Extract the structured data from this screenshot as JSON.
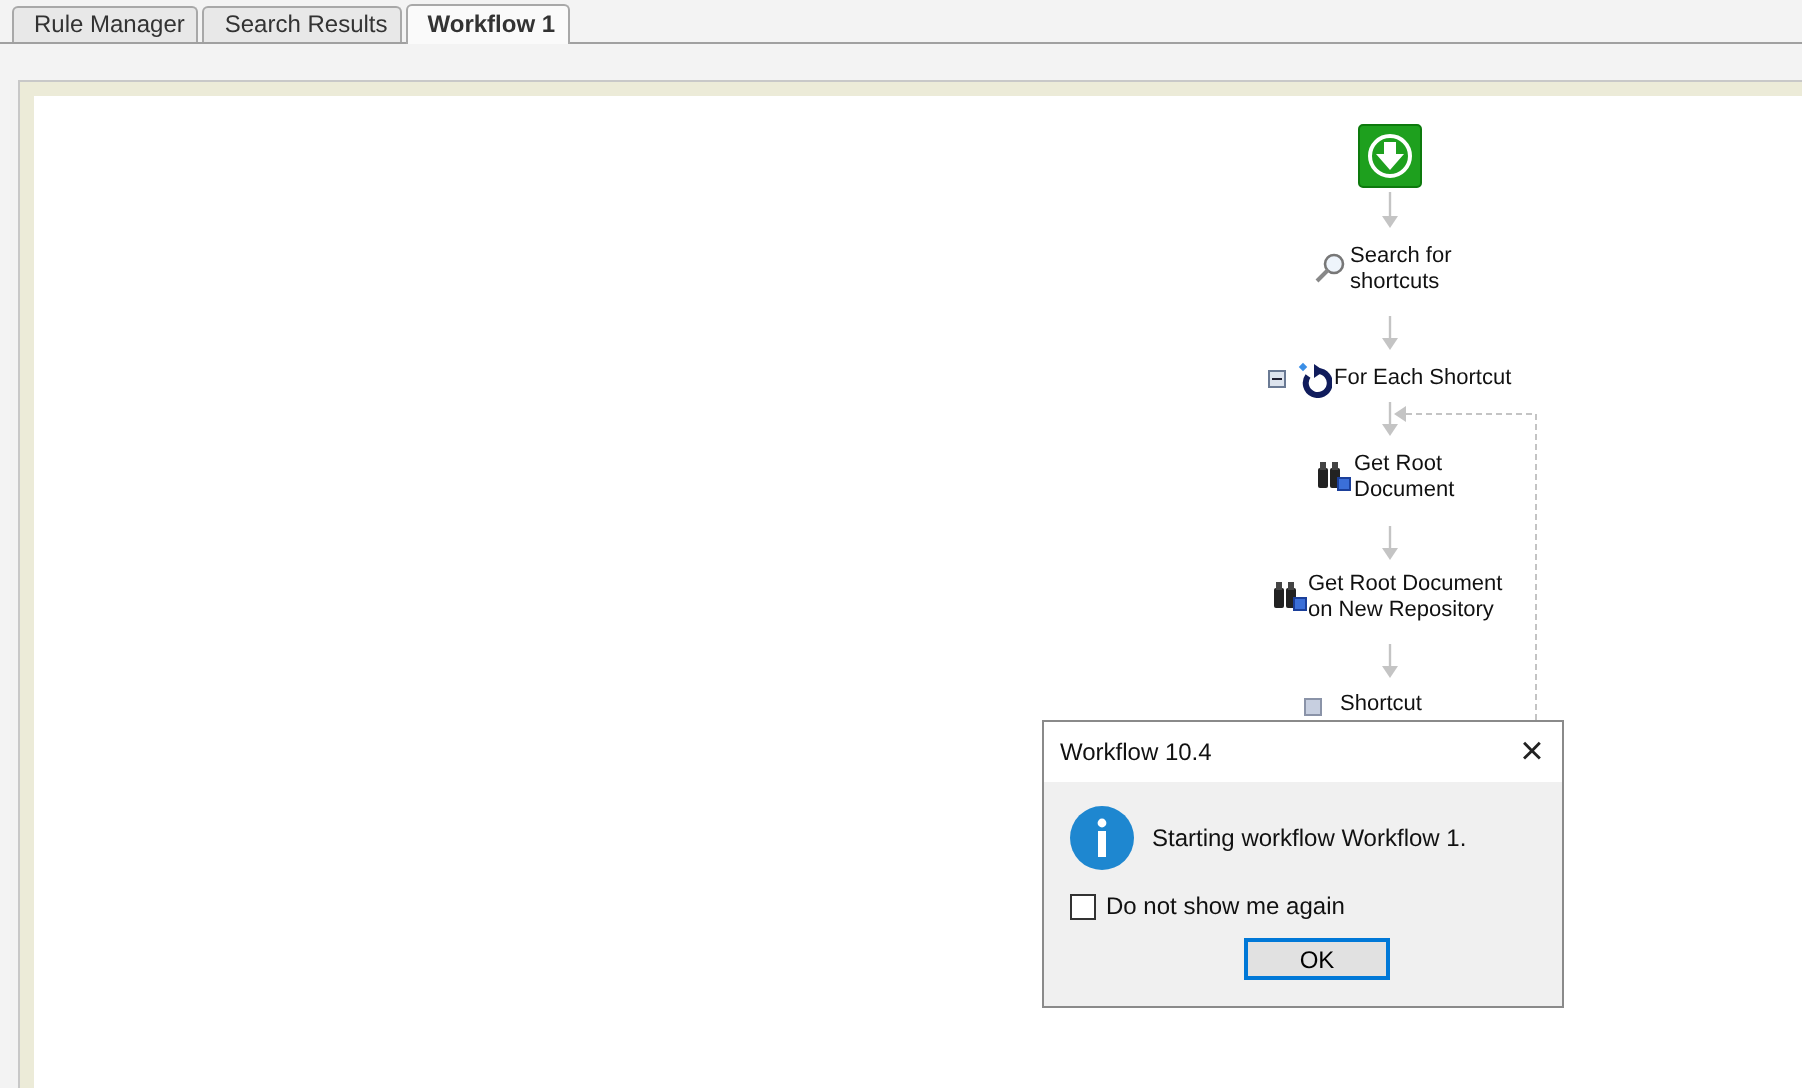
{
  "tabs": [
    {
      "label": "Rule Manager",
      "selected": false
    },
    {
      "label": "Search Results",
      "selected": false
    },
    {
      "label": "Workflow 1",
      "selected": true
    }
  ],
  "workflow": {
    "nodes": [
      {
        "kind": "start"
      },
      {
        "kind": "search",
        "label": "Search for shortcuts"
      },
      {
        "kind": "loop",
        "label": "For Each Shortcut",
        "expanded": true
      },
      {
        "kind": "binoculars",
        "label": "Get Root Document"
      },
      {
        "kind": "binoculars",
        "label": "Get Root Document on New Repository"
      },
      {
        "kind": "item",
        "label": "Shortcut"
      }
    ]
  },
  "dialog": {
    "title": "Workflow 10.4",
    "close": "×",
    "message": "Starting workflow Workflow 1.",
    "checkbox": {
      "label": "Do not show me again",
      "checked": false
    },
    "button": "OK"
  }
}
